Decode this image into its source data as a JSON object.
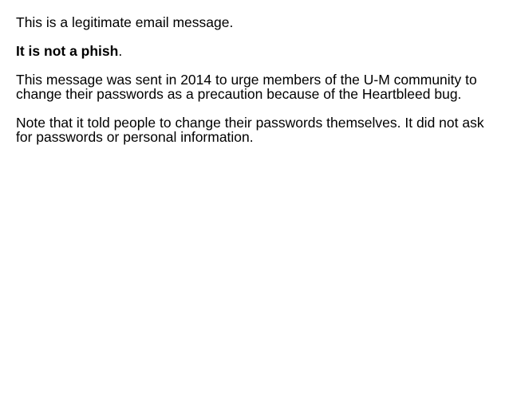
{
  "message": {
    "line1": "This is a legitimate email message.",
    "line2_bold": "It is not a phish",
    "line2_tail": ".",
    "para3": "This message was sent in 2014 to urge members of the U-M community to change their passwords as a precaution because of the Heartbleed bug.",
    "para4": "Note that it told people to change their passwords themselves. It did not ask for passwords or personal information."
  }
}
